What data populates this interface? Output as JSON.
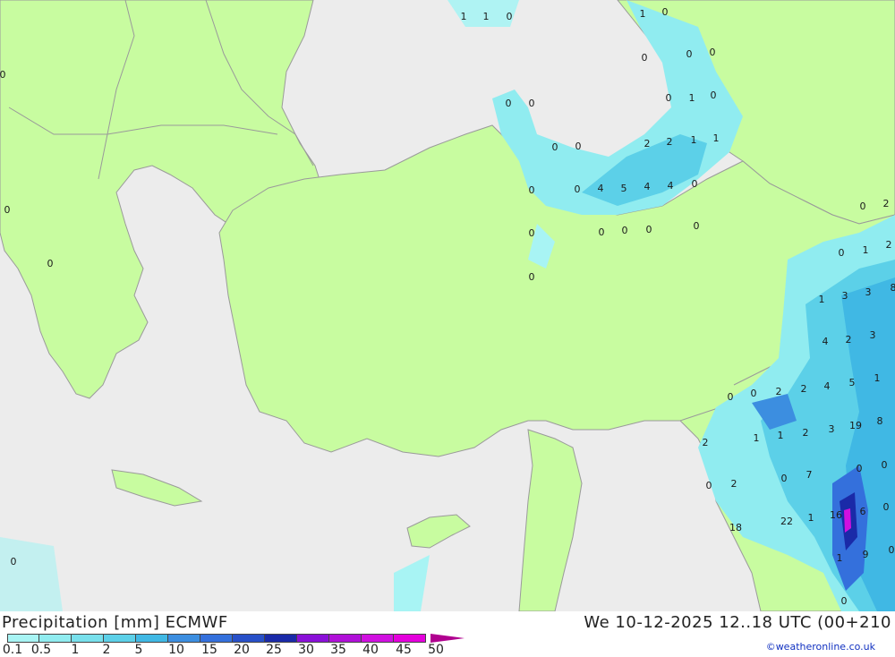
{
  "title": "Precipitation [mm] ECMWF",
  "datetime": "We 10-12-2025 12..18 UTC (00+210",
  "credit": "©weatheronline.co.uk",
  "colors": {
    "land": "#c8fca0",
    "sea": "#ececec",
    "border": "#9a9a9a",
    "arrow": "#b0008f"
  },
  "legend": {
    "ticks": [
      "0.1",
      "0.5",
      "1",
      "2",
      "5",
      "10",
      "15",
      "20",
      "25",
      "30",
      "35",
      "40",
      "45",
      "50"
    ],
    "swatches": [
      "#a8f4f4",
      "#90ecf0",
      "#78e0ec",
      "#5cd0e8",
      "#40b8e4",
      "#3c8ee0",
      "#3470dc",
      "#2850c8",
      "#1a2aa8",
      "#8a10d8",
      "#b010d8",
      "#d010e0",
      "#e400dc"
    ]
  },
  "labels": [
    "1",
    "1",
    "0",
    "1",
    "0",
    "0",
    "0",
    "0",
    "0",
    "0",
    "1",
    "0",
    "0",
    "0",
    "0",
    "2",
    "2",
    "1",
    "1",
    "0",
    "0",
    "0",
    "4",
    "5",
    "4",
    "4",
    "0",
    "0",
    "0",
    "0",
    "0",
    "0",
    "0",
    "0",
    "0",
    "0",
    "0",
    "0",
    "2",
    "1",
    "2",
    "3",
    "8",
    "1",
    "3",
    "2",
    "3",
    "4",
    "4",
    "2",
    "5",
    "1",
    "0",
    "0",
    "2",
    "2",
    "1",
    "1",
    "2",
    "3",
    "19",
    "8",
    "0",
    "0",
    "0",
    "2",
    "0",
    "7",
    "16",
    "6",
    "0",
    "18",
    "22",
    "1",
    "1",
    "9",
    "0",
    "0"
  ]
}
